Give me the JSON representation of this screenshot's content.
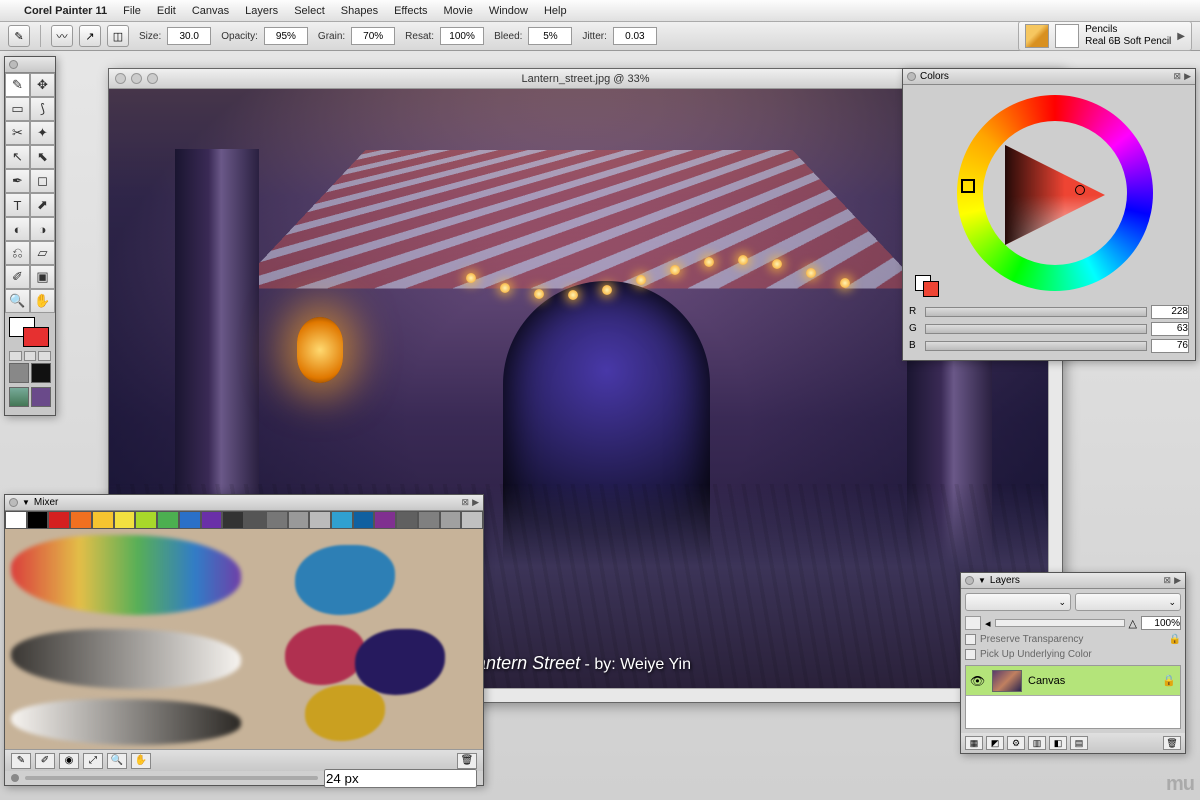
{
  "menu": {
    "apple": "",
    "appname": "Corel Painter 11",
    "items": [
      "File",
      "Edit",
      "Canvas",
      "Layers",
      "Select",
      "Shapes",
      "Effects",
      "Movie",
      "Window",
      "Help"
    ]
  },
  "props": {
    "size_label": "Size:",
    "size": "30.0",
    "opacity_label": "Opacity:",
    "opacity": "95%",
    "grain_label": "Grain:",
    "grain": "70%",
    "resat_label": "Resat:",
    "resat": "100%",
    "bleed_label": "Bleed:",
    "bleed": "5%",
    "jitter_label": "Jitter:",
    "jitter": "0.03"
  },
  "brush": {
    "category": "Pencils",
    "variant": "Real 6B Soft Pencil"
  },
  "doc": {
    "title": "Lantern_street.jpg @ 33%",
    "credit_title": "Lantern Street",
    "credit_by": " - by: Weiye Yin"
  },
  "colors": {
    "title": "Colors",
    "r_label": "R",
    "r": "228",
    "g_label": "G",
    "g": "63",
    "b_label": "B",
    "b": "76"
  },
  "mixer": {
    "title": "Mixer",
    "swatches": [
      "#ffffff",
      "#000000",
      "#d42020",
      "#f07020",
      "#f6c430",
      "#f2e040",
      "#a8d82a",
      "#4caf50",
      "#2a70c8",
      "#6a30a8",
      "#333333",
      "#555555",
      "#777777",
      "#999999",
      "#bbbbbb",
      "#30a0d0",
      "#1060a0",
      "#803090",
      "#606060",
      "#808080",
      "#a0a0a0",
      "#c0c0c0"
    ],
    "brush_size": "24 px"
  },
  "layers": {
    "title": "Layers",
    "opacity": "100%",
    "preserve": "Preserve Transparency",
    "pickup": "Pick Up Underlying Color",
    "items": [
      {
        "name": "Canvas"
      }
    ]
  },
  "watermark": "mu"
}
